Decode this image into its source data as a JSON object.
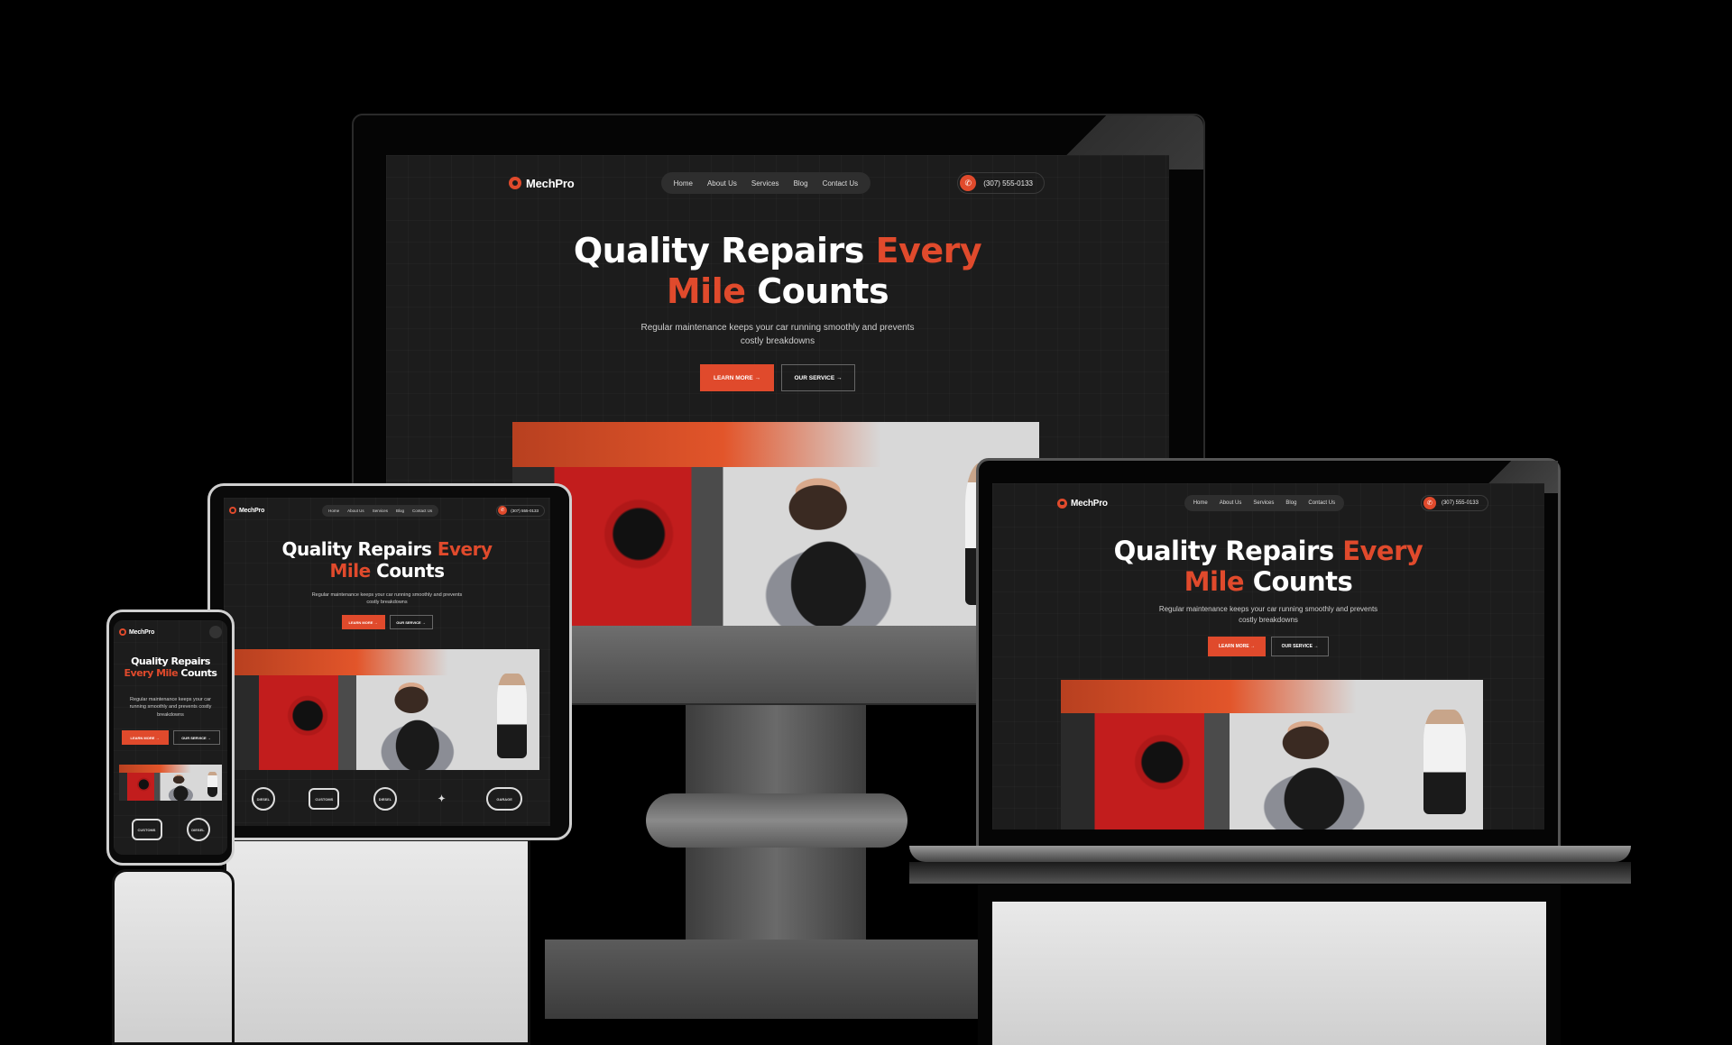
{
  "brand": {
    "name": "MechPro",
    "accent": "#e04a2c"
  },
  "nav": {
    "items": [
      "Home",
      "About Us",
      "Services",
      "Blog",
      "Contact Us"
    ],
    "phone": "(307) 555-0133"
  },
  "hero": {
    "title_line1_a": "Quality Repairs ",
    "title_line1_b": "Every",
    "title_line2_a": "Mile",
    "title_line2_b": " Counts",
    "subtitle_line1": "Regular maintenance keeps your car running smoothly and prevents",
    "subtitle_line2": "costly breakdowns",
    "btn_primary": "LEARN MORE →",
    "btn_secondary": "OUR SERVICE →"
  },
  "mobile_hero": {
    "title_line1": "Quality Repairs",
    "title_line2_a": "Every Mile",
    "title_line2_b": " Counts",
    "subtitle": "Regular maintenance keeps your car running smoothly and prevents costly breakdowns"
  },
  "partner_logos": [
    "DIESEL",
    "CUSTOMS",
    "DIESEL",
    "✦",
    "GARAGE"
  ],
  "mobile_logos": [
    "CUSTOMS",
    "DIESEL"
  ]
}
